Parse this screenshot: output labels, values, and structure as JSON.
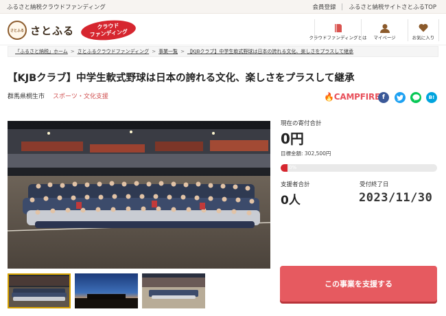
{
  "topbar": {
    "tagline": "ふるさと納税クラウドファンディング",
    "links": [
      "会員登録",
      "ふるさと納税サイトさとふるTOP"
    ]
  },
  "header": {
    "logo_text": "さとふる",
    "logo_mark_text": "さとふる",
    "badge_line1": "クラウド",
    "badge_line2": "ファンディング",
    "nav": [
      {
        "label": "クラウドファンディングとは",
        "icon": "book-icon"
      },
      {
        "label": "マイページ",
        "icon": "user-icon"
      },
      {
        "label": "お気に入り",
        "icon": "heart-icon"
      }
    ]
  },
  "breadcrumb": {
    "items": [
      "「ふるさと納税」ホーム",
      "さとふるクラウドファンディング",
      "事業一覧",
      "【KJBクラブ】中学生軟式野球は日本の誇れる文化、楽しさをプラスして継承"
    ],
    "separator": ">"
  },
  "project": {
    "title": "【KJBクラブ】中学生軟式野球は日本の誇れる文化、楽しさをプラスして継承",
    "location": "群馬県桐生市",
    "category": "スポーツ・文化支援",
    "partner": "CAMPFIRE",
    "share_labels": {
      "facebook": "f",
      "twitter": "t",
      "line": "L",
      "hatena": "B!"
    }
  },
  "funding": {
    "current_label": "現在の寄付合計",
    "current_value": "0円",
    "target_label": "目標金額: 302,500円",
    "progress_text": "0%",
    "progress_fraction": 0.0,
    "supporters_label": "支援者合計",
    "supporters_value": "0人",
    "deadline_label": "受付終了日",
    "deadline_value": "2023/11/30",
    "support_button": "この事業を支援する"
  },
  "colors": {
    "accent": "#d6262f",
    "button": "#e65a60",
    "campfire": "#e8505b"
  }
}
